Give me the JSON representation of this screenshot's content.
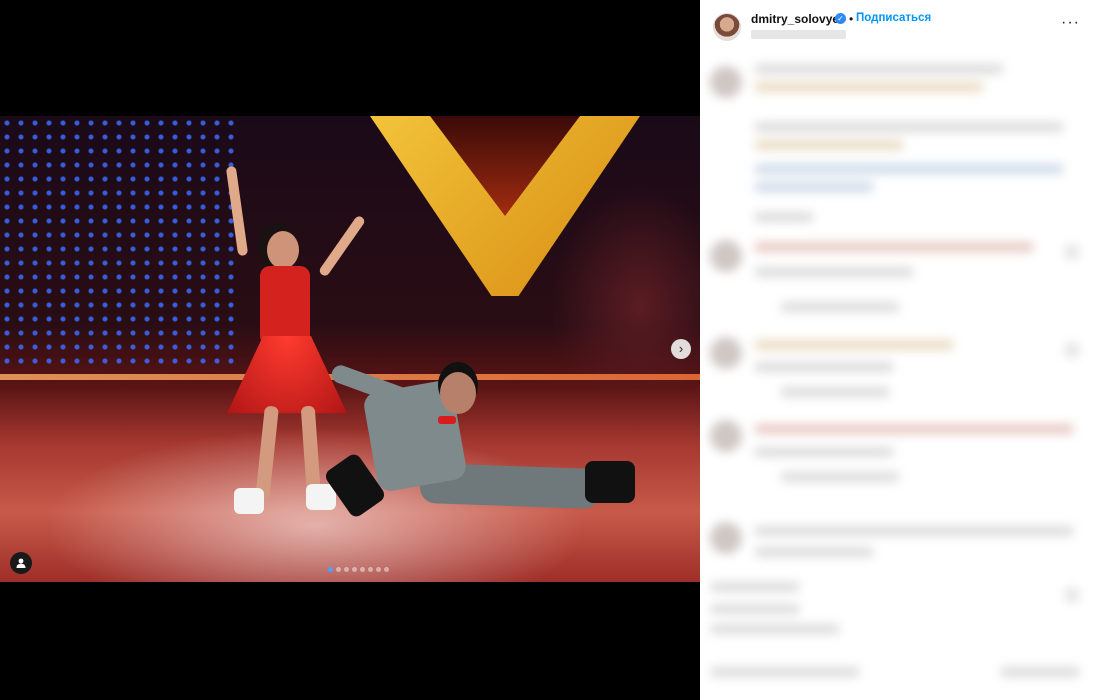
{
  "post": {
    "username": "dmitry_solovyev",
    "separator": "•",
    "follow_label": "Подписаться",
    "more_icon_glyph": "···"
  },
  "media": {
    "next_arrow_glyph": "›",
    "carousel_dots": 8,
    "active_dot": 0
  },
  "colors": {
    "follow_blue": "#0095f6",
    "verified_blue": "#2f8af5",
    "active_dot": "#4aa3ff"
  },
  "icons": {
    "next": "chevron-right-icon",
    "tags": "user-tag-icon",
    "verified": "verified-badge-icon",
    "more": "more-options-icon"
  }
}
